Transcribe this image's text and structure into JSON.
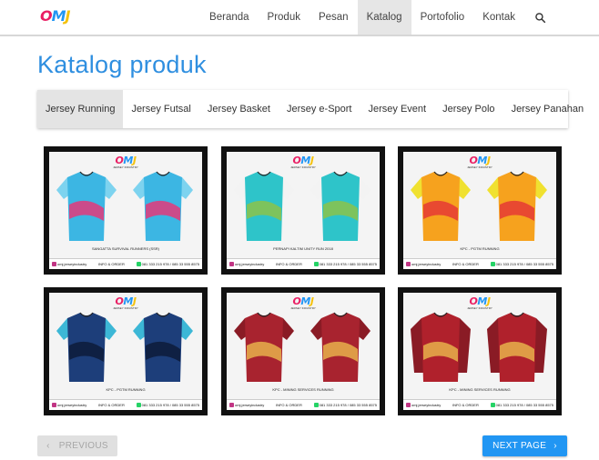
{
  "brand": {
    "logo_text": "OMJ"
  },
  "nav": {
    "items": [
      {
        "label": "Beranda",
        "active": false
      },
      {
        "label": "Produk",
        "active": false
      },
      {
        "label": "Pesan",
        "active": false
      },
      {
        "label": "Katalog",
        "active": true
      },
      {
        "label": "Portofolio",
        "active": false
      },
      {
        "label": "Kontak",
        "active": false
      }
    ],
    "search_icon": "search-icon"
  },
  "page": {
    "title": "Katalog produk"
  },
  "tabs": [
    {
      "label": "Jersey Running",
      "active": true
    },
    {
      "label": "Jersey Futsal",
      "active": false
    },
    {
      "label": "Jersey Basket",
      "active": false
    },
    {
      "label": "Jersey e-Sport",
      "active": false
    },
    {
      "label": "Jersey Event",
      "active": false
    },
    {
      "label": "Jersey Polo",
      "active": false
    },
    {
      "label": "Jersey Panahan",
      "active": false
    }
  ],
  "card_common": {
    "logo": "OMJ",
    "subtitle": "JERSEY INDUSTRY",
    "instagram": "omj.jerseyindustry",
    "info": "INFO & ORDER",
    "phone": "081 333 215 978 / 085 33 555 8575"
  },
  "products": [
    {
      "caption": "SANGATTA SURVIVAL RUNNERS (SSR)",
      "colors": [
        "#3cb6e3",
        "#7dd3ef",
        "#e4387a"
      ],
      "sleeve": "short"
    },
    {
      "caption": "PERNAPI KALTIM UNITY RUN 2018",
      "colors": [
        "#2ec4c9",
        "#f3f3f3",
        "#8bc34a"
      ],
      "sleeve": "short"
    },
    {
      "caption": "KPC - PGTM RUNNING",
      "colors": [
        "#f6a21e",
        "#f0e130",
        "#e53935"
      ],
      "sleeve": "short"
    },
    {
      "caption": "KPC - PGTM RUNNING",
      "colors": [
        "#1d3e7a",
        "#3cb7d6",
        "#0d1b3a"
      ],
      "sleeve": "short"
    },
    {
      "caption": "KPC - MINING SERVICES RUNNING",
      "colors": [
        "#a8232f",
        "#8a1b25",
        "#e8b04b"
      ],
      "sleeve": "short"
    },
    {
      "caption": "KPC - MINING SERVICES RUNNING",
      "colors": [
        "#b0212c",
        "#8a1b25",
        "#e8b04b"
      ],
      "sleeve": "long"
    }
  ],
  "pagination": {
    "prev_label": "PREVIOUS",
    "next_label": "NEXT PAGE"
  },
  "colors": {
    "accent": "#2196f3",
    "title": "#2f8fe0"
  }
}
